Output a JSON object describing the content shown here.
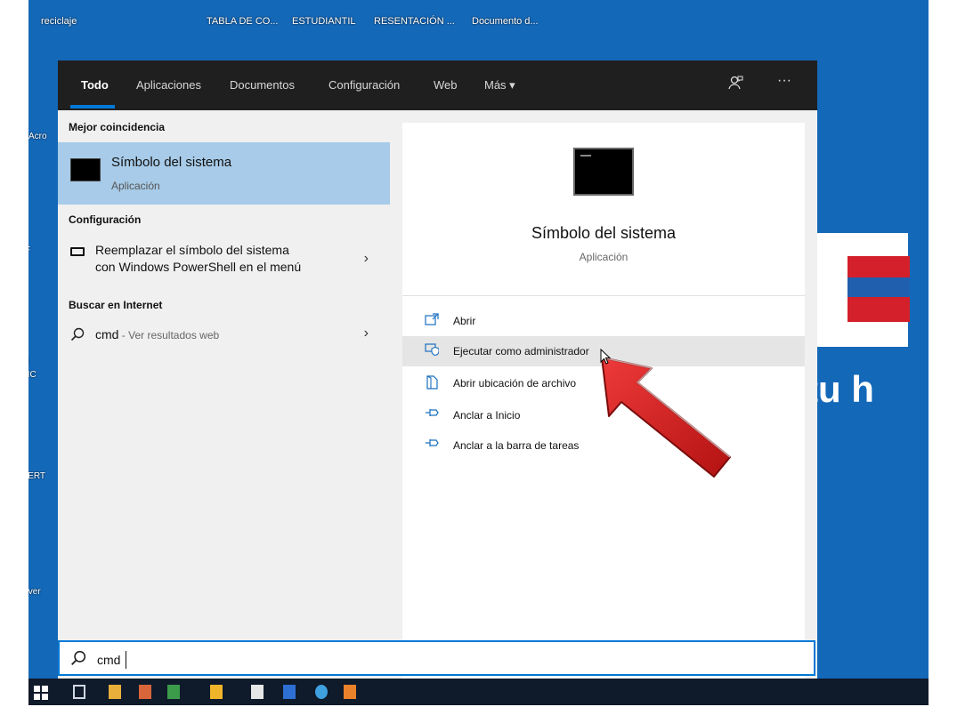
{
  "desktop": {
    "top_labels": [
      "reciclaje",
      "TABLA DE CO...",
      "ESTUDIANTIL",
      "RESENTACIÓN ...",
      "Documento d..."
    ],
    "left_labels": [
      "Acro",
      "F",
      "B",
      "PIC",
      "CERT",
      "inver"
    ],
    "tagline": "tu h"
  },
  "tabs": [
    {
      "label": "Todo",
      "active": true
    },
    {
      "label": "Aplicaciones"
    },
    {
      "label": "Documentos"
    },
    {
      "label": "Configuración"
    },
    {
      "label": "Web"
    },
    {
      "label": "Más ▾"
    }
  ],
  "top_icons": {
    "feedback": "feedback-icon",
    "more": "···"
  },
  "results": {
    "best_header": "Mejor coincidencia",
    "best": {
      "title": "Símbolo del sistema",
      "subtitle": "Aplicación"
    },
    "config_header": "Configuración",
    "config_item": {
      "line1": "Reemplazar el símbolo del sistema",
      "line2": "con Windows PowerShell en el menú"
    },
    "internet_header": "Buscar en Internet",
    "web_item": {
      "query": "cmd",
      "suffix": " - Ver resultados web"
    }
  },
  "detail": {
    "title": "Símbolo del sistema",
    "subtitle": "Aplicación",
    "actions": [
      {
        "label": "Abrir",
        "icon": "open-icon"
      },
      {
        "label": "Ejecutar como administrador",
        "icon": "admin-shield-icon"
      },
      {
        "label": "Abrir ubicación de archivo",
        "icon": "file-location-icon"
      },
      {
        "label": "Anclar a Inicio",
        "icon": "pin-icon"
      },
      {
        "label": "Anclar a la barra de tareas",
        "icon": "pin-icon"
      }
    ]
  },
  "search": {
    "value": "cmd"
  },
  "colors": {
    "accent": "#0078d7",
    "selected": "#a7cbe8",
    "arrow": "#d01c1c"
  }
}
